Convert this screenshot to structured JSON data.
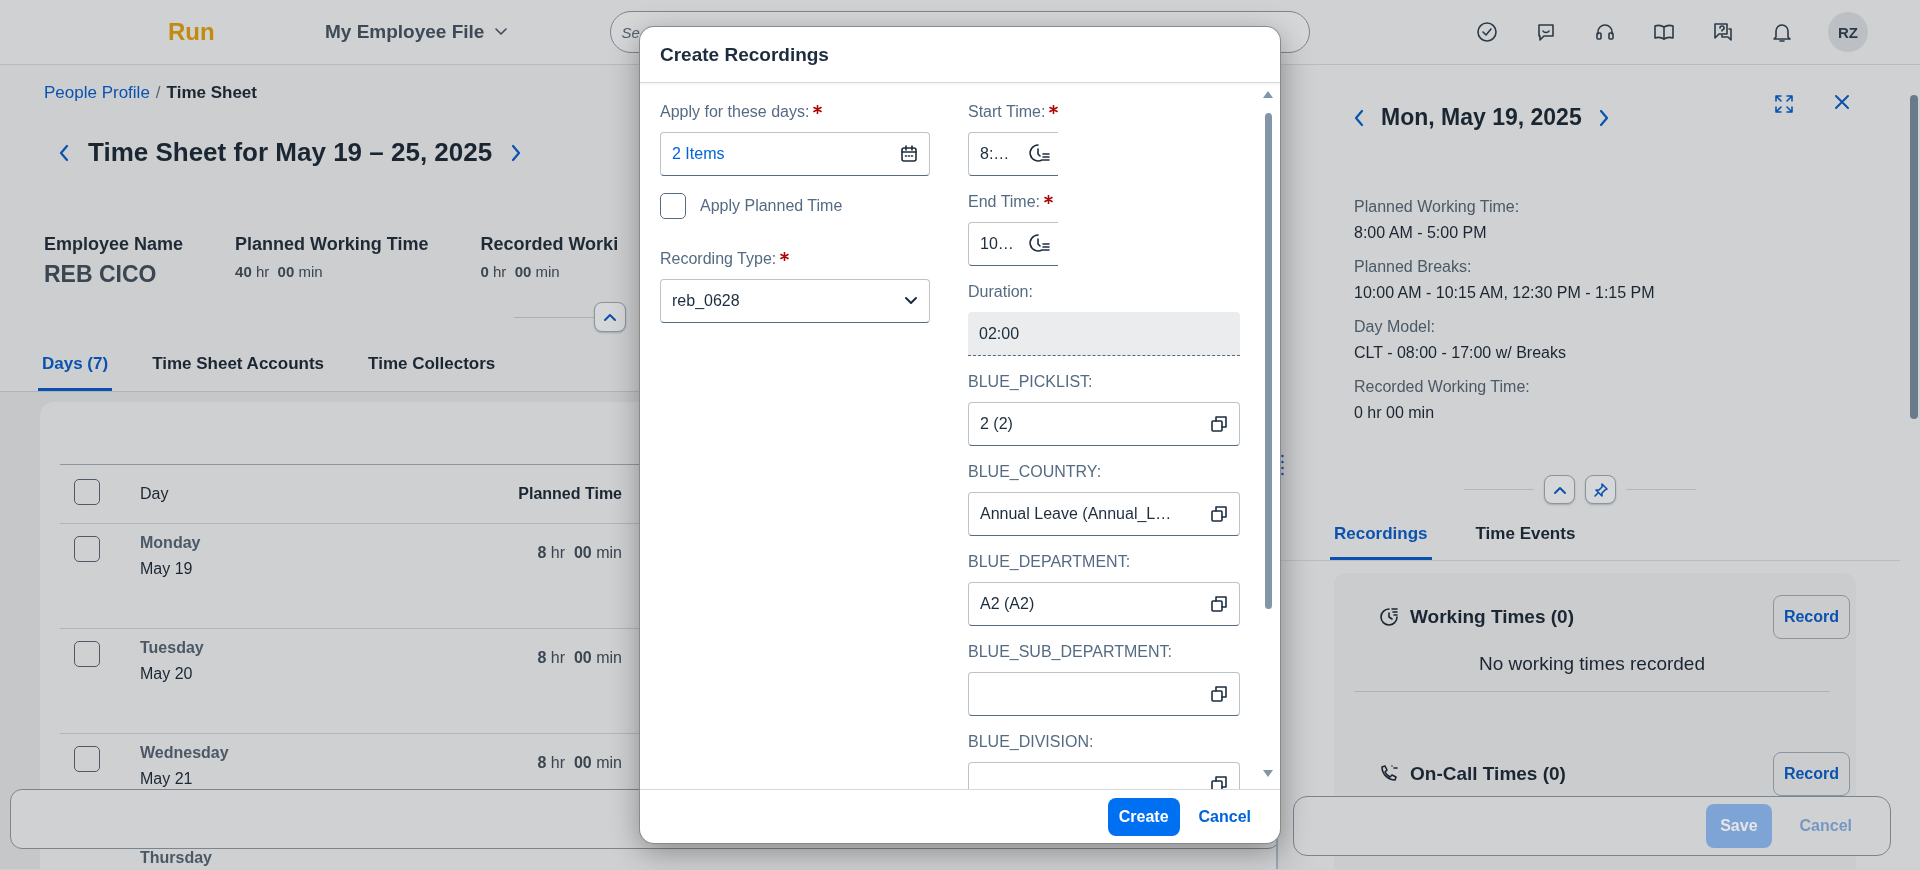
{
  "header": {
    "logo": "Run",
    "app_menu": "My Employee File",
    "search": {
      "placeholder": "Se"
    },
    "avatar": "RZ"
  },
  "breadcrumb": {
    "separator": "/",
    "items": [
      {
        "label": "People Profile",
        "kind": "link"
      },
      {
        "label": "Time Sheet",
        "kind": "current"
      }
    ]
  },
  "page_title": "Time Sheet for May 19 – 25, 2025",
  "summary": {
    "employee": {
      "label": "Employee Name",
      "value": "REB CICO"
    },
    "kpis": [
      {
        "label": "Planned Working Time",
        "value": "**40** hr  **00** min"
      },
      {
        "label": "Recorded Worki",
        "value": "**0** hr  **00** min"
      }
    ]
  },
  "tabs": [
    {
      "label": "Days (7)",
      "selected": true
    },
    {
      "label": "Time Sheet Accounts",
      "selected": false
    },
    {
      "label": "Time Collectors",
      "selected": false
    }
  ],
  "table": {
    "select_all": {
      "checked": false
    },
    "columns": [
      "Day",
      "Planned Time"
    ],
    "rows": [
      {
        "weekday": "Monday",
        "date": "May 19",
        "planned": "**8** hr  **00** min",
        "checked": false
      },
      {
        "weekday": "Tuesday",
        "date": "May 20",
        "planned": "**8** hr  **00** min",
        "checked": false
      },
      {
        "weekday": "Wednesday",
        "date": "May 21",
        "planned": "**8** hr  **00** min",
        "checked": false
      },
      {
        "weekday": "Thursday"
      }
    ]
  },
  "dialog": {
    "title": "Create Recordings",
    "left_fields": [
      {
        "kind": "multi",
        "label": "Apply for these days:",
        "required": true,
        "value": "2 Items"
      },
      {
        "kind": "checkbox",
        "label": "Apply Planned Time",
        "checked": false
      },
      {
        "kind": "select",
        "label": "Recording Type:",
        "required": true,
        "value": "reb_0628"
      }
    ],
    "right_fields": [
      {
        "kind": "time",
        "label": "Start Time:",
        "required": true,
        "value": "8:…"
      },
      {
        "kind": "time",
        "label": "End Time:",
        "required": true,
        "value": "10…"
      },
      {
        "kind": "readonly",
        "label": "Duration:",
        "required": false,
        "value": "02:00"
      },
      {
        "kind": "picker",
        "label": "BLUE_PICKLIST:",
        "required": false,
        "value": "2 (2)"
      },
      {
        "kind": "picker",
        "label": "BLUE_COUNTRY:",
        "required": false,
        "value": "Annual Leave (Annual_L…"
      },
      {
        "kind": "picker",
        "label": "BLUE_DEPARTMENT:",
        "required": false,
        "value": "A2 (A2)"
      },
      {
        "kind": "picker",
        "label": "BLUE_SUB_DEPARTMENT:",
        "required": false
      },
      {
        "kind": "picker",
        "label": "BLUE_DIVISION:",
        "required": false
      }
    ],
    "buttons": [
      {
        "label": "Create",
        "kind": "primary"
      },
      {
        "label": "Cancel",
        "kind": "transparent"
      }
    ]
  },
  "detail": {
    "title": "Mon, May 19, 2025",
    "info": [
      {
        "label": "Planned Working Time:",
        "value": "8:00 AM - 5:00 PM"
      },
      {
        "label": "Planned Breaks:",
        "value": "10:00 AM - 10:15 AM, 12:30 PM - 1:15 PM"
      },
      {
        "label": "Day Model:",
        "value": "CLT - 08:00 - 17:00 w/ Breaks"
      },
      {
        "label": "Recorded Working Time:",
        "value": "0 hr 00 min"
      }
    ],
    "tabs": [
      {
        "label": "Recordings",
        "selected": true
      },
      {
        "label": "Time Events",
        "selected": false
      }
    ],
    "sections": [
      {
        "kind": "working",
        "title": "Working Times (0)",
        "button": "Record",
        "empty_text": "No working times recorded"
      },
      {
        "kind": "oncall",
        "title": "On-Call Times (0)",
        "button": "Record"
      }
    ],
    "footer_buttons": [
      {
        "label": "Save",
        "kind": "primary",
        "disabled": true
      },
      {
        "label": "Cancel",
        "kind": "transparent",
        "disabled": true
      }
    ]
  }
}
